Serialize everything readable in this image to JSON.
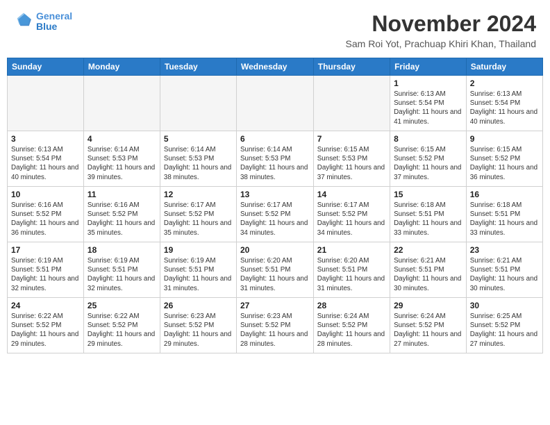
{
  "header": {
    "logo_line1": "General",
    "logo_line2": "Blue",
    "month_title": "November 2024",
    "location": "Sam Roi Yot, Prachuap Khiri Khan, Thailand"
  },
  "days_of_week": [
    "Sunday",
    "Monday",
    "Tuesday",
    "Wednesday",
    "Thursday",
    "Friday",
    "Saturday"
  ],
  "weeks": [
    [
      {
        "day": "",
        "info": ""
      },
      {
        "day": "",
        "info": ""
      },
      {
        "day": "",
        "info": ""
      },
      {
        "day": "",
        "info": ""
      },
      {
        "day": "",
        "info": ""
      },
      {
        "day": "1",
        "info": "Sunrise: 6:13 AM\nSunset: 5:54 PM\nDaylight: 11 hours and 41 minutes."
      },
      {
        "day": "2",
        "info": "Sunrise: 6:13 AM\nSunset: 5:54 PM\nDaylight: 11 hours and 40 minutes."
      }
    ],
    [
      {
        "day": "3",
        "info": "Sunrise: 6:13 AM\nSunset: 5:54 PM\nDaylight: 11 hours and 40 minutes."
      },
      {
        "day": "4",
        "info": "Sunrise: 6:14 AM\nSunset: 5:53 PM\nDaylight: 11 hours and 39 minutes."
      },
      {
        "day": "5",
        "info": "Sunrise: 6:14 AM\nSunset: 5:53 PM\nDaylight: 11 hours and 38 minutes."
      },
      {
        "day": "6",
        "info": "Sunrise: 6:14 AM\nSunset: 5:53 PM\nDaylight: 11 hours and 38 minutes."
      },
      {
        "day": "7",
        "info": "Sunrise: 6:15 AM\nSunset: 5:53 PM\nDaylight: 11 hours and 37 minutes."
      },
      {
        "day": "8",
        "info": "Sunrise: 6:15 AM\nSunset: 5:52 PM\nDaylight: 11 hours and 37 minutes."
      },
      {
        "day": "9",
        "info": "Sunrise: 6:15 AM\nSunset: 5:52 PM\nDaylight: 11 hours and 36 minutes."
      }
    ],
    [
      {
        "day": "10",
        "info": "Sunrise: 6:16 AM\nSunset: 5:52 PM\nDaylight: 11 hours and 36 minutes."
      },
      {
        "day": "11",
        "info": "Sunrise: 6:16 AM\nSunset: 5:52 PM\nDaylight: 11 hours and 35 minutes."
      },
      {
        "day": "12",
        "info": "Sunrise: 6:17 AM\nSunset: 5:52 PM\nDaylight: 11 hours and 35 minutes."
      },
      {
        "day": "13",
        "info": "Sunrise: 6:17 AM\nSunset: 5:52 PM\nDaylight: 11 hours and 34 minutes."
      },
      {
        "day": "14",
        "info": "Sunrise: 6:17 AM\nSunset: 5:52 PM\nDaylight: 11 hours and 34 minutes."
      },
      {
        "day": "15",
        "info": "Sunrise: 6:18 AM\nSunset: 5:51 PM\nDaylight: 11 hours and 33 minutes."
      },
      {
        "day": "16",
        "info": "Sunrise: 6:18 AM\nSunset: 5:51 PM\nDaylight: 11 hours and 33 minutes."
      }
    ],
    [
      {
        "day": "17",
        "info": "Sunrise: 6:19 AM\nSunset: 5:51 PM\nDaylight: 11 hours and 32 minutes."
      },
      {
        "day": "18",
        "info": "Sunrise: 6:19 AM\nSunset: 5:51 PM\nDaylight: 11 hours and 32 minutes."
      },
      {
        "day": "19",
        "info": "Sunrise: 6:19 AM\nSunset: 5:51 PM\nDaylight: 11 hours and 31 minutes."
      },
      {
        "day": "20",
        "info": "Sunrise: 6:20 AM\nSunset: 5:51 PM\nDaylight: 11 hours and 31 minutes."
      },
      {
        "day": "21",
        "info": "Sunrise: 6:20 AM\nSunset: 5:51 PM\nDaylight: 11 hours and 31 minutes."
      },
      {
        "day": "22",
        "info": "Sunrise: 6:21 AM\nSunset: 5:51 PM\nDaylight: 11 hours and 30 minutes."
      },
      {
        "day": "23",
        "info": "Sunrise: 6:21 AM\nSunset: 5:51 PM\nDaylight: 11 hours and 30 minutes."
      }
    ],
    [
      {
        "day": "24",
        "info": "Sunrise: 6:22 AM\nSunset: 5:52 PM\nDaylight: 11 hours and 29 minutes."
      },
      {
        "day": "25",
        "info": "Sunrise: 6:22 AM\nSunset: 5:52 PM\nDaylight: 11 hours and 29 minutes."
      },
      {
        "day": "26",
        "info": "Sunrise: 6:23 AM\nSunset: 5:52 PM\nDaylight: 11 hours and 29 minutes."
      },
      {
        "day": "27",
        "info": "Sunrise: 6:23 AM\nSunset: 5:52 PM\nDaylight: 11 hours and 28 minutes."
      },
      {
        "day": "28",
        "info": "Sunrise: 6:24 AM\nSunset: 5:52 PM\nDaylight: 11 hours and 28 minutes."
      },
      {
        "day": "29",
        "info": "Sunrise: 6:24 AM\nSunset: 5:52 PM\nDaylight: 11 hours and 27 minutes."
      },
      {
        "day": "30",
        "info": "Sunrise: 6:25 AM\nSunset: 5:52 PM\nDaylight: 11 hours and 27 minutes."
      }
    ]
  ]
}
